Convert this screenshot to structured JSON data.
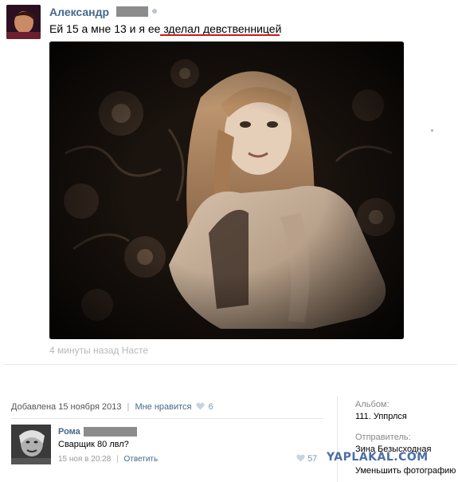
{
  "post": {
    "author": "Александр",
    "text": "Ей 15 а мне 13 и я ее зделал девственницей",
    "timestamp": "4 минуты назад Насте"
  },
  "photo_meta": {
    "added": "Добавлена 15 ноября 2013",
    "like_label": "Мне нравится",
    "like_count": "6"
  },
  "comment": {
    "author": "Рома",
    "text": "Сварщик 80 лвл?",
    "date": "15 ноя в 20:28",
    "reply_label": "Ответить",
    "likes": "57"
  },
  "sidebar": {
    "album_label": "Альбом:",
    "album_value": "111. Уппрлся",
    "sender_label": "Отправитель:",
    "sender_value": "Зина Безысходная",
    "shrink_link": "Уменьшить фотографию"
  },
  "watermark": "YAPLAKAL.COM",
  "colors": {
    "link_blue": "#45688e",
    "underline_red": "#d11818",
    "redaction_gray": "#8c8c8c"
  }
}
